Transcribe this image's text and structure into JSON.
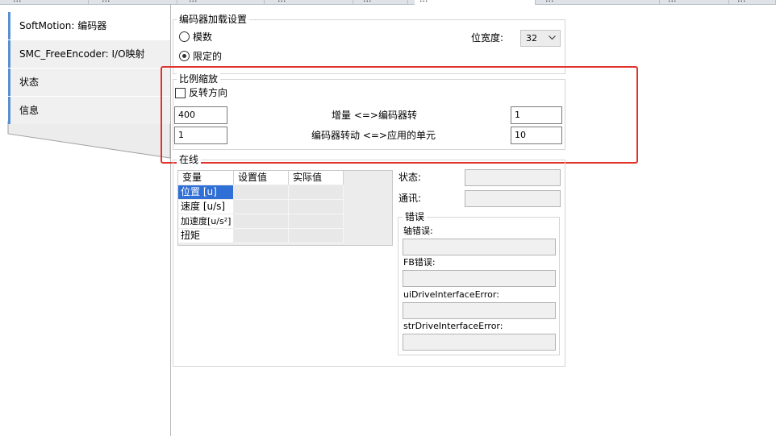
{
  "top_tabs": [
    {
      "label": "...",
      "active": false
    },
    {
      "label": "...",
      "active": false
    },
    {
      "label": "...",
      "active": false
    },
    {
      "label": "...",
      "active": false
    },
    {
      "label": "...",
      "active": false
    },
    {
      "label": "...",
      "active": true
    },
    {
      "label": "...",
      "active": false
    },
    {
      "label": "...",
      "active": false
    },
    {
      "label": "...",
      "active": false
    }
  ],
  "sidebar": {
    "items": [
      {
        "label": "SoftMotion: 编码器",
        "active": true
      },
      {
        "label": "SMC_FreeEncoder: I/O映射",
        "active": false
      },
      {
        "label": "状态",
        "active": false
      },
      {
        "label": "信息",
        "active": false
      }
    ]
  },
  "encoder_settings": {
    "title": "编码器加载设置",
    "radio_modulo": "模数",
    "radio_limited": "限定的",
    "selected": "限定的",
    "bitwidth_label": "位宽度:",
    "bitwidth_value": "32"
  },
  "scaling": {
    "title": "比例缩放",
    "invert_label": "反转方向",
    "invert_checked": false,
    "row1": {
      "left": "400",
      "label": "增量 <=>编码器转",
      "right": "1"
    },
    "row2": {
      "left": "1",
      "label": "编码器转动 <=>应用的单元",
      "right": "10"
    }
  },
  "online": {
    "title": "在线",
    "headers": [
      "变量",
      "设置值",
      "实际值"
    ],
    "rows": [
      {
        "label": "位置 [u]",
        "selected": true
      },
      {
        "label": "速度 [u/s]",
        "selected": false
      },
      {
        "label": "加速度[u/s²]",
        "selected": false
      },
      {
        "label": "扭矩",
        "selected": false
      }
    ],
    "status_label": "状态:",
    "comm_label": "通讯:"
  },
  "errors": {
    "title": "错误",
    "axis_error_label": "轴错误:",
    "fb_error_label": "FB错误:",
    "ui_drive_error_label": "uiDriveInterfaceError:",
    "str_drive_error_label": "strDriveInterfaceError:"
  },
  "colors": {
    "highlight": "#e0332c",
    "selection": "#2f6fd6",
    "nav_accent": "#5a8fd0"
  }
}
